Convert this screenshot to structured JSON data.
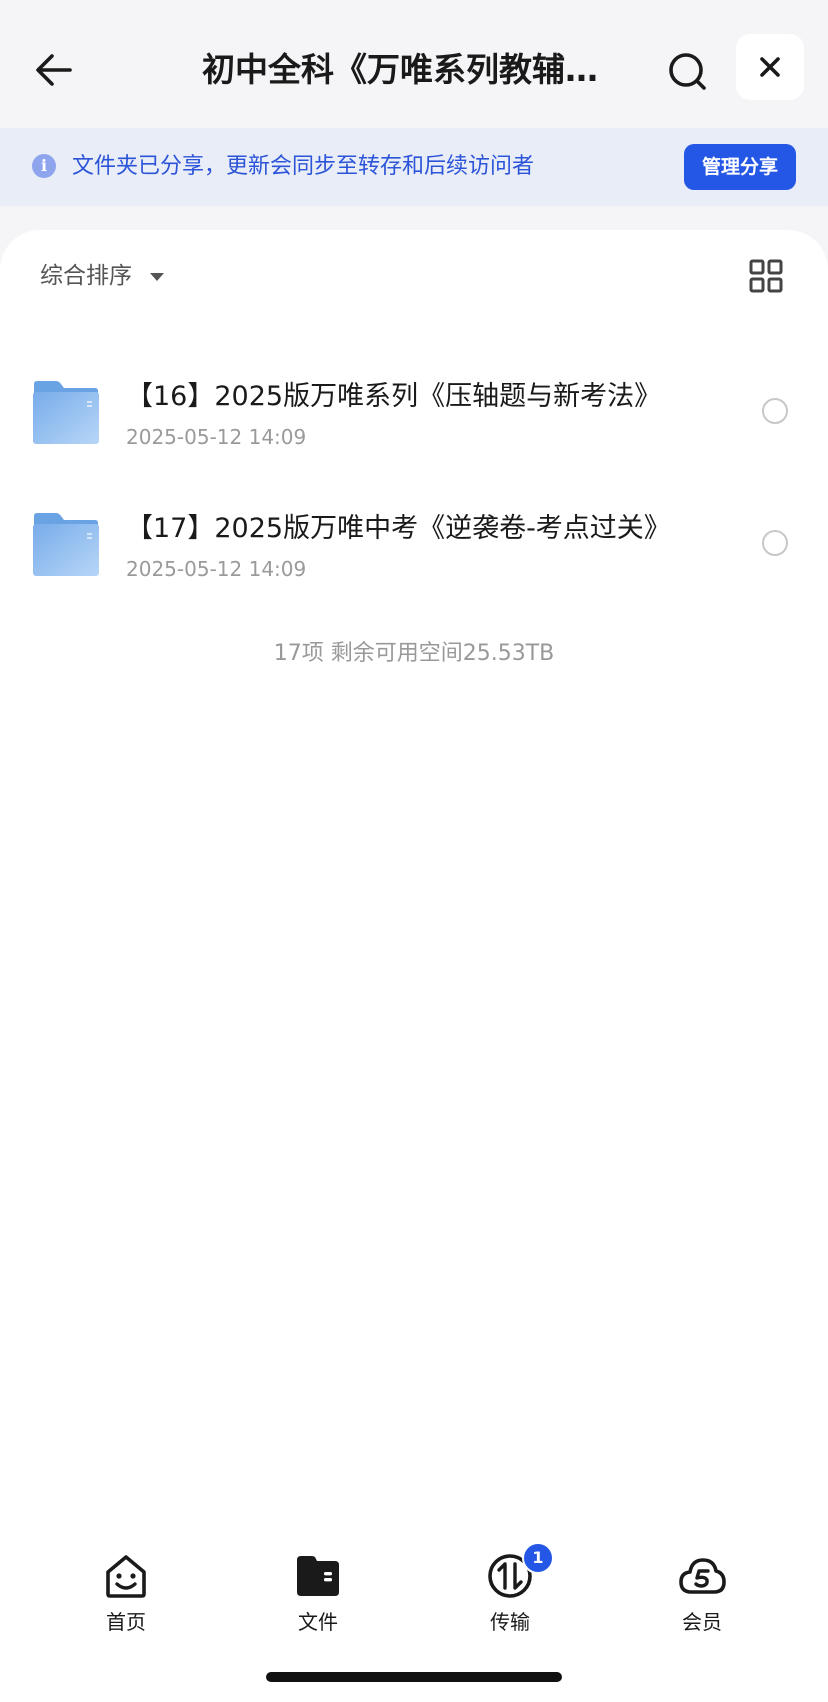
{
  "header": {
    "title": "初中全科《万唯系列教辅…"
  },
  "share_banner": {
    "message": "文件夹已分享，更新会同步至转存和后续访问者",
    "manage_label": "管理分享",
    "info_glyph": "i"
  },
  "toolbar": {
    "sort_label": "综合排序"
  },
  "files": [
    {
      "name": "【16】2025版万唯系列《压轴题与新考法》",
      "date": "2025-05-12 14:09"
    },
    {
      "name": "【17】2025版万唯中考《逆袭卷-考点过关》",
      "date": "2025-05-12 14:09"
    }
  ],
  "summary": "17项 剩余可用空间25.53TB",
  "bottom_nav": {
    "items": [
      {
        "label": "首页",
        "icon": "home-icon"
      },
      {
        "label": "文件",
        "icon": "folder-icon"
      },
      {
        "label": "传输",
        "icon": "transfer-icon",
        "badge": "1"
      },
      {
        "label": "会员",
        "icon": "member-cloud-icon"
      }
    ]
  },
  "colors": {
    "accent": "#2457e6",
    "banner_bg": "#e9edf8",
    "banner_text": "#2c54d8",
    "folder": "#7fb2ec"
  }
}
